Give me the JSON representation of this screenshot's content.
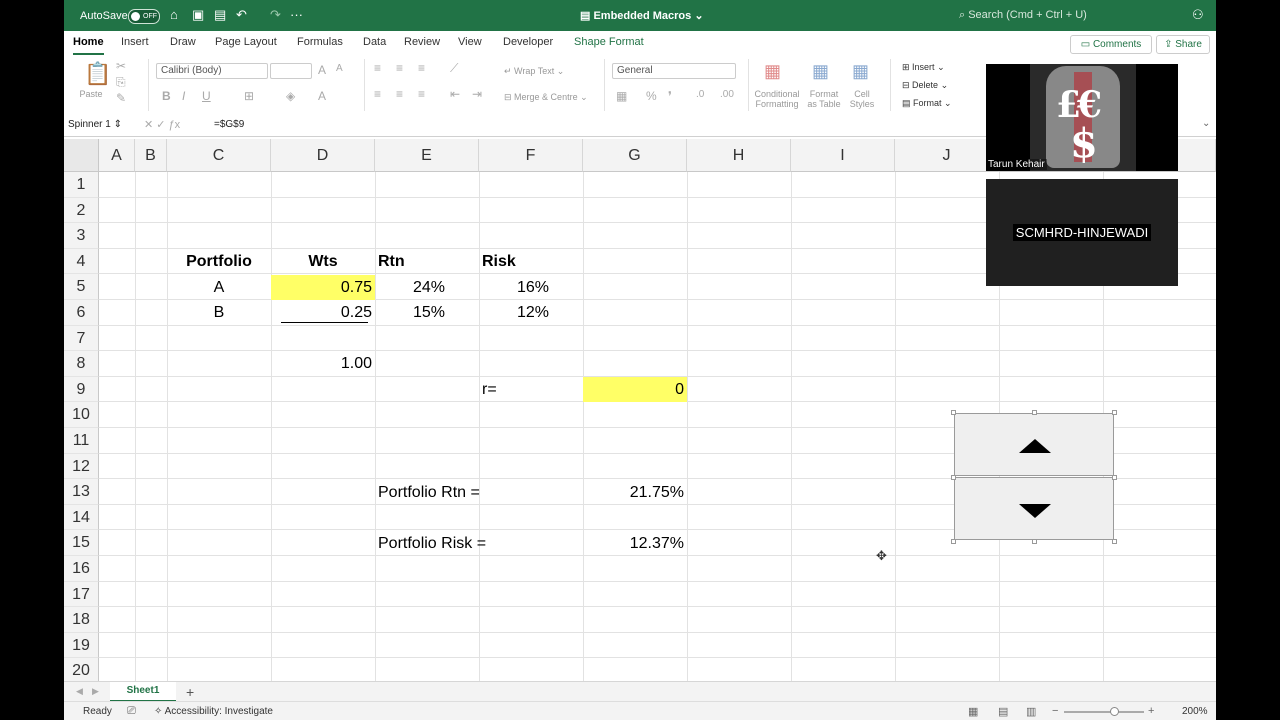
{
  "titlebar": {
    "autosave_label": "AutoSave",
    "autosave_state": "OFF",
    "title": "Embedded Macros",
    "search_placeholder": "Search (Cmd + Ctrl + U)"
  },
  "ribbon_tabs": [
    "Home",
    "Insert",
    "Draw",
    "Page Layout",
    "Formulas",
    "Data",
    "Review",
    "View",
    "Developer",
    "Shape Format"
  ],
  "header_buttons": {
    "comments": "Comments",
    "share": "Share"
  },
  "ribbon": {
    "paste": "Paste",
    "font_name": "Calibri (Body)",
    "wrap_text": "Wrap Text",
    "merge_centre": "Merge & Centre",
    "number_format": "General",
    "conditional_formatting": "Conditional Formatting",
    "format_as_table": "Format as Table",
    "cell_styles": "Cell Styles",
    "insert": "Insert",
    "delete": "Delete",
    "format": "Format"
  },
  "formula_bar": {
    "name_box": "Spinner 1",
    "formula": "=$G$9"
  },
  "columns": [
    "A",
    "B",
    "C",
    "D",
    "E",
    "F",
    "G",
    "H",
    "I",
    "J"
  ],
  "rows": [
    "1",
    "2",
    "3",
    "4",
    "5",
    "6",
    "7",
    "8",
    "9",
    "10",
    "11",
    "12",
    "13",
    "14",
    "15",
    "16",
    "17",
    "18",
    "19",
    "20"
  ],
  "cells": {
    "c4": "Portfolio",
    "d4": "Wts",
    "e4": "Rtn",
    "f4": "Risk",
    "c5": "A",
    "d5": "0.75",
    "e5": "24%",
    "f5": "16%",
    "c6": "B",
    "d6": "0.25",
    "e6": "15%",
    "f6": "12%",
    "d8": "1.00",
    "f9": "r=",
    "g9": "0",
    "e13": "Portfolio Rtn =",
    "g13": "21.75%",
    "e15": "Portfolio Risk =",
    "g15": "12.37%"
  },
  "sheet_tab": "Sheet1",
  "status": {
    "ready": "Ready",
    "accessibility": "Accessibility: Investigate",
    "zoom": "200%"
  },
  "video": {
    "participant_name": "Tarun Kehair",
    "room_label": "SCMHRD-HINJEWADI"
  }
}
